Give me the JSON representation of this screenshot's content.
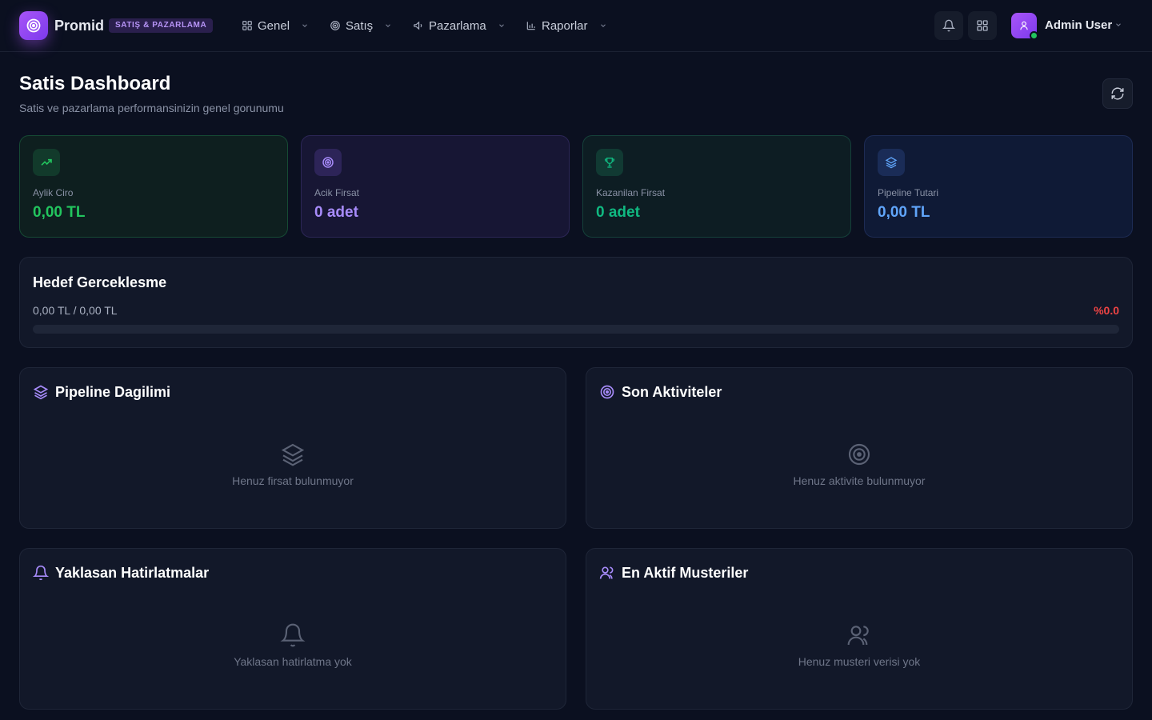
{
  "brand": {
    "name": "Promid",
    "badge": "SATIŞ & PAZARLAMA"
  },
  "nav": {
    "items": [
      {
        "label": "Genel",
        "icon": "grid-icon"
      },
      {
        "label": "Satış",
        "icon": "target-icon"
      },
      {
        "label": "Pazarlama",
        "icon": "megaphone-icon"
      },
      {
        "label": "Raporlar",
        "icon": "bar-chart-icon"
      }
    ]
  },
  "user": {
    "name": "Admin User",
    "status_color": "#22c55e"
  },
  "page": {
    "title": "Satis Dashboard",
    "subtitle": "Satis ve pazarlama performansinizin genel gorunumu"
  },
  "stats": [
    {
      "label": "Aylik Ciro",
      "value": "0,00 TL",
      "icon": "trend-up-icon",
      "color": "#22c55e"
    },
    {
      "label": "Acik Firsat",
      "value": "0 adet",
      "icon": "target-icon",
      "color": "#a78bfa"
    },
    {
      "label": "Kazanilan Firsat",
      "value": "0 adet",
      "icon": "trophy-icon",
      "color": "#10b981"
    },
    {
      "label": "Pipeline Tutari",
      "value": "0,00 TL",
      "icon": "layers-icon",
      "color": "#60a5fa"
    }
  ],
  "goal": {
    "title": "Hedef Gerceklesme",
    "amount": "0,00 TL / 0,00 TL",
    "percent_label": "%0.0",
    "progress": 0
  },
  "panels": {
    "pipeline": {
      "title": "Pipeline Dagilimi",
      "empty": "Henuz firsat bulunmuyor",
      "icon": "layers-icon"
    },
    "activities": {
      "title": "Son Aktiviteler",
      "empty": "Henuz aktivite bulunmuyor",
      "icon": "target-icon"
    },
    "reminders": {
      "title": "Yaklasan Hatirlatmalar",
      "empty": "Yaklasan hatirlatma yok",
      "icon": "bell-icon"
    },
    "customers": {
      "title": "En Aktif Musteriler",
      "empty": "Henuz musteri verisi yok",
      "icon": "users-icon"
    }
  },
  "colors": {
    "accent": "#a855f7",
    "danger": "#ef4444"
  }
}
